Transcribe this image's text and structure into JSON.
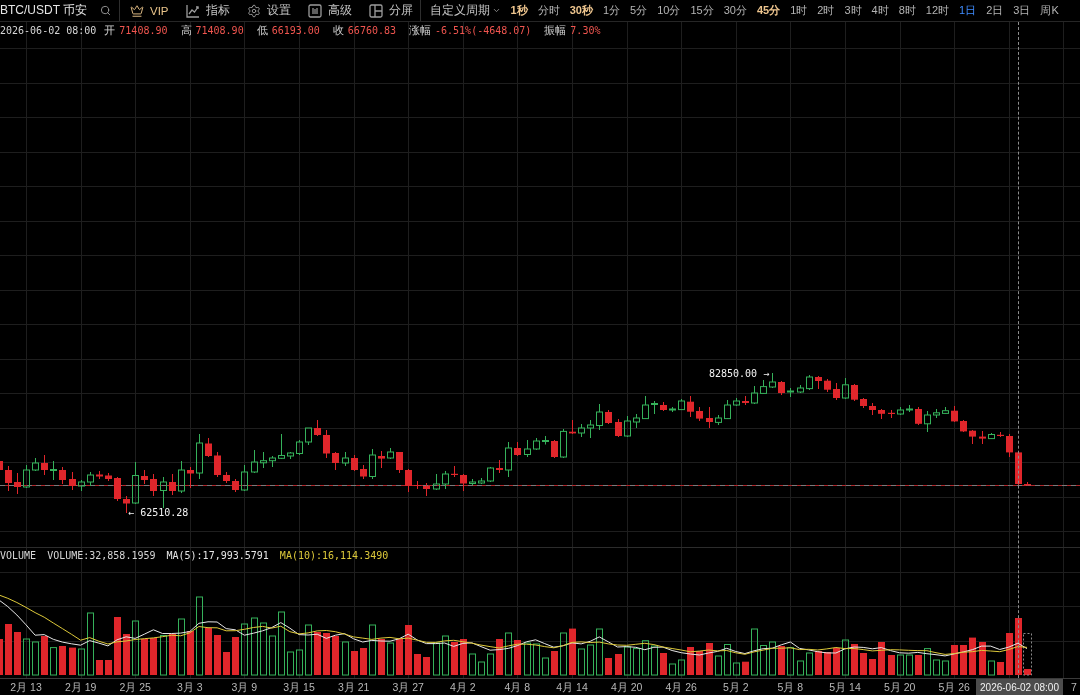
{
  "toolbar": {
    "symbol": "BTC/USDT 币安",
    "tools": [
      {
        "kind": "vip",
        "label": "VIP"
      },
      {
        "kind": "indicators",
        "label": "指标"
      },
      {
        "kind": "settings",
        "label": "设置"
      },
      {
        "kind": "advanced",
        "label": "高级"
      },
      {
        "kind": "split",
        "label": "分屏"
      }
    ],
    "custom_period": "自定义周期",
    "periods": [
      {
        "label": "1秒",
        "vip": true,
        "selected": false
      },
      {
        "label": "分时",
        "vip": false,
        "selected": false
      },
      {
        "label": "30秒",
        "vip": true,
        "selected": false
      },
      {
        "label": "1分",
        "vip": false,
        "selected": false
      },
      {
        "label": "5分",
        "vip": false,
        "selected": false
      },
      {
        "label": "10分",
        "vip": false,
        "selected": false
      },
      {
        "label": "15分",
        "vip": false,
        "selected": false
      },
      {
        "label": "30分",
        "vip": false,
        "selected": false
      },
      {
        "label": "45分",
        "vip": true,
        "selected": false
      },
      {
        "label": "1时",
        "vip": false,
        "selected": false
      },
      {
        "label": "2时",
        "vip": false,
        "selected": false
      },
      {
        "label": "3时",
        "vip": false,
        "selected": false
      },
      {
        "label": "4时",
        "vip": false,
        "selected": false
      },
      {
        "label": "8时",
        "vip": false,
        "selected": false
      },
      {
        "label": "12时",
        "vip": false,
        "selected": false
      },
      {
        "label": "1日",
        "vip": false,
        "selected": true
      },
      {
        "label": "2日",
        "vip": false,
        "selected": false
      },
      {
        "label": "3日",
        "vip": false,
        "selected": false
      },
      {
        "label": "周K",
        "vip": false,
        "selected": false
      }
    ]
  },
  "ohlc_info": {
    "time": "2026-06-02 08:00",
    "fields": [
      {
        "label": "开",
        "value": "71408.90"
      },
      {
        "label": "高",
        "value": "71408.90"
      },
      {
        "label": "低",
        "value": "66193.00"
      },
      {
        "label": "收",
        "value": "66760.83"
      },
      {
        "label": "涨幅",
        "value": "-6.51%(-4648.07)"
      },
      {
        "label": "振幅",
        "value": "7.30%"
      }
    ]
  },
  "price_chart": {
    "high_label": "82850.00 →",
    "low_label": "← 62510.28"
  },
  "volume_panel": {
    "title": "VOLUME",
    "indicators": [
      {
        "kind": "volume",
        "label": "VOLUME:32,858.1959"
      },
      {
        "kind": "ma5",
        "label": "MA(5):17,993.5791"
      },
      {
        "kind": "ma10",
        "label": "MA(10):16,114.3490"
      }
    ]
  },
  "time_axis": {
    "labels": [
      "2月 13",
      "2月 19",
      "2月 25",
      "3月 3",
      "3月 9",
      "3月 15",
      "3月 21",
      "3月 27",
      "4月 2",
      "4月 8",
      "4月 14",
      "4月 20",
      "4月 26",
      "5月 2",
      "5月 8",
      "5月 14",
      "5月 20",
      "5月 26"
    ],
    "edge_label": "7",
    "crosshair_label": "2026-06-02 08:00"
  }
}
